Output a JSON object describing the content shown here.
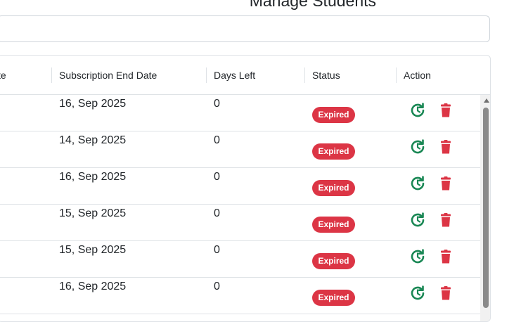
{
  "page": {
    "title": "Manage Students"
  },
  "search": {
    "value": ""
  },
  "table": {
    "columns": {
      "start_date_partial": "te",
      "subscription_end_date": "Subscription End Date",
      "days_left": "Days Left",
      "status": "Status",
      "action": "Action"
    },
    "rows": [
      {
        "subscription_end_date": "16, Sep 2025",
        "days_left": "0",
        "status": "Expired"
      },
      {
        "subscription_end_date": "14, Sep 2025",
        "days_left": "0",
        "status": "Expired"
      },
      {
        "subscription_end_date": "16, Sep 2025",
        "days_left": "0",
        "status": "Expired"
      },
      {
        "subscription_end_date": "15, Sep 2025",
        "days_left": "0",
        "status": "Expired"
      },
      {
        "subscription_end_date": "15, Sep 2025",
        "days_left": "0",
        "status": "Expired"
      },
      {
        "subscription_end_date": "16, Sep 2025",
        "days_left": "0",
        "status": "Expired"
      }
    ]
  },
  "icons": {
    "renew": "renew-icon",
    "delete": "trash-icon"
  },
  "colors": {
    "expired_badge": "#dc3545",
    "renew_icon": "#198754",
    "delete_icon": "#dc3545"
  }
}
